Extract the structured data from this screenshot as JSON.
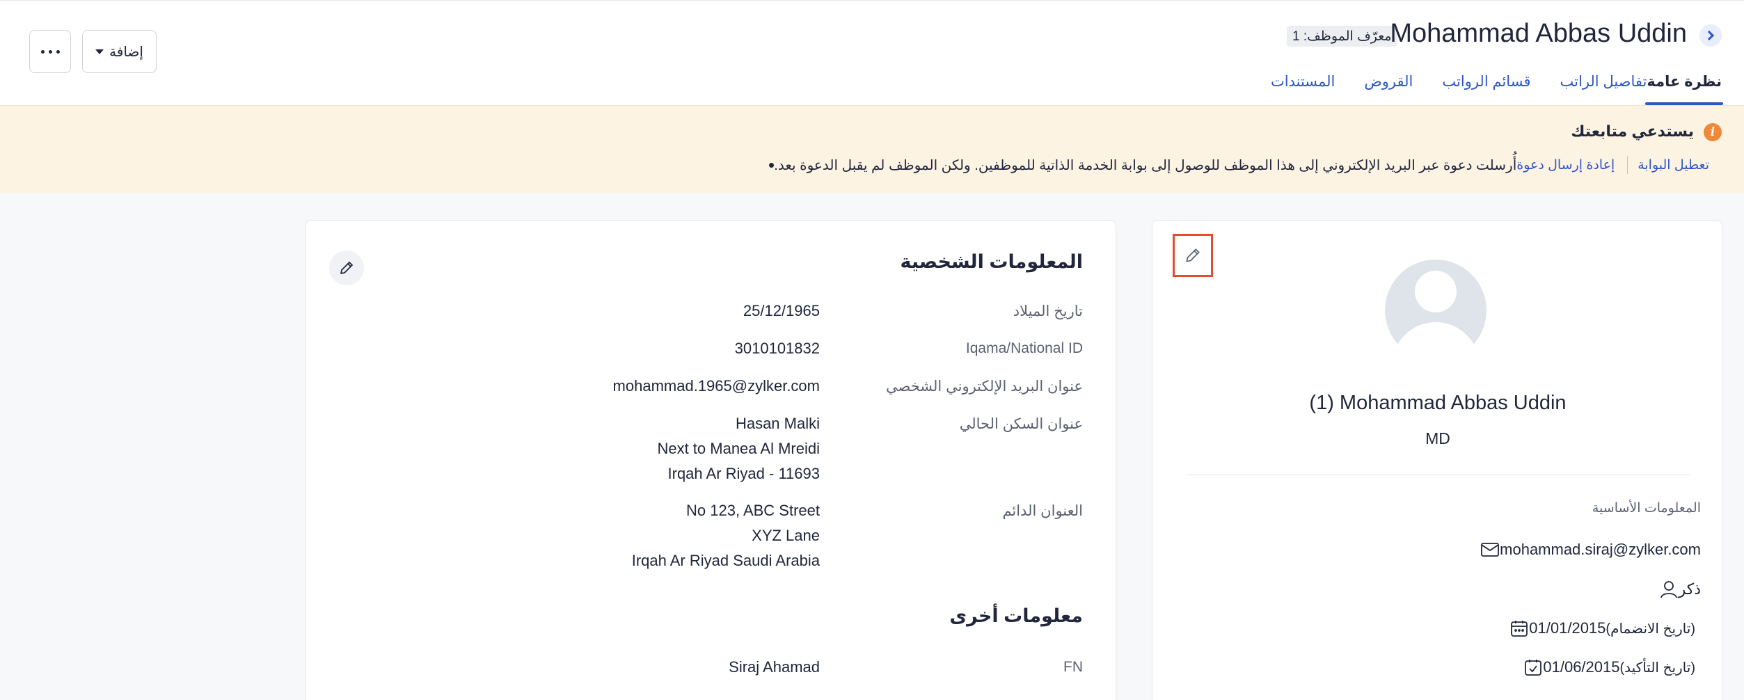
{
  "header": {
    "employee_name": "Mohammad Abbas Uddin",
    "employee_id": "معرّف الموظف: 1",
    "add_label": "إضافة",
    "tabs": [
      {
        "label": "نظرة عامة",
        "active": true
      },
      {
        "label": "تفاصيل الراتب",
        "active": false
      },
      {
        "label": "قسائم الرواتب",
        "active": false
      },
      {
        "label": "القروض",
        "active": false
      },
      {
        "label": "المستندات",
        "active": false
      }
    ]
  },
  "alert": {
    "title": "يستدعي متابعتك",
    "message": "أُرسلت دعوة عبر البريد الإلكتروني إلى هذا الموظف للوصول إلى بوابة الخدمة الذاتية للموظفين. ولكن الموظف لم يقبل الدعوة بعد.",
    "resend_link": "إعادة إرسال دعوة",
    "disable_link": "تعطيل البوابة",
    "icon": "info-icon",
    "color": "#f0883a"
  },
  "personal": {
    "title": "المعلومات الشخصية",
    "rows": [
      {
        "label": "تاريخ الميلاد",
        "value": [
          "25/12/1965"
        ]
      },
      {
        "label": "Iqama/National ID",
        "value": [
          "3010101832"
        ]
      },
      {
        "label": "عنوان البريد الإلكتروني الشخصي",
        "value": [
          "mohammad.1965@zylker.com"
        ]
      },
      {
        "label": "عنوان السكن الحالي",
        "value": [
          "Hasan Malki",
          "Next to Manea Al Mreidi",
          "Irqah  Ar Riyad - 11693"
        ]
      },
      {
        "label": "العنوان الدائم",
        "value": [
          "No 123, ABC Street",
          "XYZ Lane",
          "Irqah  Ar Riyad  Saudi Arabia"
        ]
      }
    ]
  },
  "other": {
    "title": "معلومات أخرى",
    "rows": [
      {
        "label": "FN",
        "value": [
          "Siraj Ahamad"
        ]
      }
    ]
  },
  "profile": {
    "name": "(1) Mohammad Abbas Uddin",
    "role": "MD",
    "basic_info_label": "المعلومات الأساسية",
    "email": "mohammad.siraj@zylker.com",
    "gender": "ذكر",
    "join_date": "01/01/2015",
    "join_label": "(تاريخ الانضمام)",
    "confirm_date": "01/06/2015",
    "confirm_label": "(تاريخ التأكيد)"
  },
  "colors": {
    "accent": "#2f56c6",
    "alert_bg": "#fdf3e3",
    "highlight": "#e34c2f"
  }
}
